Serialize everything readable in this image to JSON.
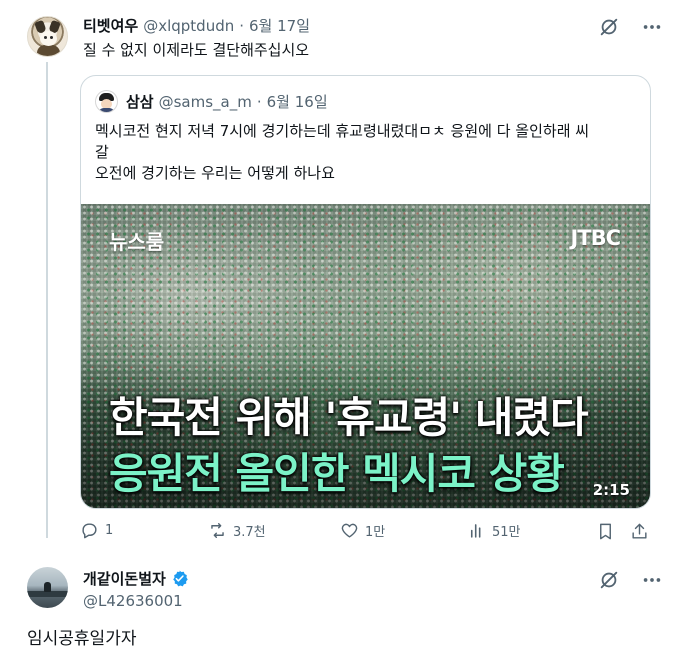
{
  "tweet1": {
    "author_name": "티벳여우",
    "handle": "@xlqptdudn",
    "separator": "·",
    "date": "6월 17일",
    "text": "질 수 없지 이제라도 결단해주십시오",
    "quote": {
      "author_name": "삼삼",
      "handle": "@sams_a_m",
      "separator": "·",
      "date": "6월 16일",
      "text_lines": [
        "멕시코전 현지 저녁 7시에 경기하는데 휴교령내렸대ㅁㅊ 응원에 다 올인하래 씨",
        "갈",
        "오전에 경기하는 우리는 어떻게 하나요"
      ],
      "video": {
        "corner_label": "뉴스룸",
        "channel_logo": "JTBC",
        "headline_line1": "한국전 위해 '휴교령' 내렸다",
        "headline_line2": "응원전 올인한 멕시코 상황",
        "duration": "2:15"
      }
    },
    "actions": {
      "replies": "1",
      "reposts": "3.7천",
      "likes": "1만",
      "views": "51만"
    }
  },
  "tweet2": {
    "author_name": "개같이돈벌자",
    "verified": true,
    "handle": "@L42636001",
    "text": "임시공휴일가자"
  },
  "colors": {
    "text_primary": "#0f1419",
    "text_secondary": "#536471",
    "border": "#cfd9de",
    "verified_blue": "#1d9bf0",
    "headline_green": "#7bf2c7"
  },
  "icons": {
    "grok": "grok-icon",
    "more": "more-icon",
    "reply": "reply-icon",
    "repost": "repost-icon",
    "like": "like-icon",
    "views": "views-icon",
    "bookmark": "bookmark-icon",
    "share": "share-icon",
    "verified": "verified-badge-icon"
  }
}
